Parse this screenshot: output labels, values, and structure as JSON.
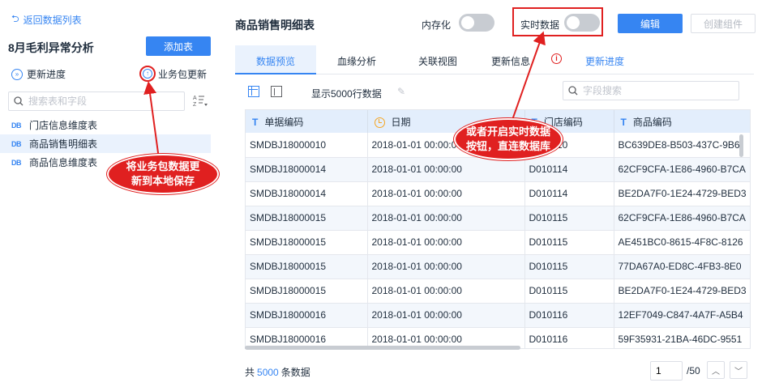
{
  "left": {
    "back_label": "返回数据列表",
    "package_title": "8月毛利异常分析",
    "add_table_label": "添加表",
    "update_progress_label": "更新进度",
    "package_update_label": "业务包更新",
    "search_placeholder": "搜索表和字段",
    "tables": [
      {
        "label": "门店信息维度表",
        "active": false
      },
      {
        "label": "商品销售明细表",
        "active": true
      },
      {
        "label": "商品信息维度表",
        "active": false
      }
    ]
  },
  "main": {
    "title": "商品销售明细表",
    "memory_label": "内存化",
    "realtime_label": "实时数据",
    "edit_label": "编辑",
    "create_component_label": "创建组件",
    "tabs": [
      {
        "label": "数据预览",
        "active": true
      },
      {
        "label": "血缘分析",
        "active": false
      },
      {
        "label": "关联视图",
        "active": false
      },
      {
        "label": "更新信息",
        "active": false
      },
      {
        "label": "更新进度",
        "active": false
      }
    ],
    "row_count_label": "显示5000行数据",
    "field_search_placeholder": "字段搜索"
  },
  "table": {
    "columns": [
      {
        "type": "T",
        "label": "单据编码"
      },
      {
        "type": "clock",
        "label": "日期"
      },
      {
        "type": "T",
        "label": "门店编码"
      },
      {
        "type": "T",
        "label": "商品编码"
      }
    ],
    "rows": [
      [
        "SMDBJ18000010",
        "2018-01-01 00:00:00",
        "D010110",
        "BC639DE8-B503-437C-9B6"
      ],
      [
        "SMDBJ18000014",
        "2018-01-01 00:00:00",
        "D010114",
        "62CF9CFA-1E86-4960-B7CA"
      ],
      [
        "SMDBJ18000014",
        "2018-01-01 00:00:00",
        "D010114",
        "BE2DA7F0-1E24-4729-BED3"
      ],
      [
        "SMDBJ18000015",
        "2018-01-01 00:00:00",
        "D010115",
        "62CF9CFA-1E86-4960-B7CA"
      ],
      [
        "SMDBJ18000015",
        "2018-01-01 00:00:00",
        "D010115",
        "AE451BC0-8615-4F8C-8126"
      ],
      [
        "SMDBJ18000015",
        "2018-01-01 00:00:00",
        "D010115",
        "77DA67A0-ED8C-4FB3-8E0"
      ],
      [
        "SMDBJ18000015",
        "2018-01-01 00:00:00",
        "D010115",
        "BE2DA7F0-1E24-4729-BED3"
      ],
      [
        "SMDBJ18000016",
        "2018-01-01 00:00:00",
        "D010116",
        "12EF7049-C847-4A7F-A5B4"
      ],
      [
        "SMDBJ18000016",
        "2018-01-01 00:00:00",
        "D010116",
        "59F35931-21BA-46DC-9551"
      ]
    ]
  },
  "footer": {
    "total_prefix": "共",
    "total_count": "5000",
    "total_suffix": "条数据",
    "page_value": "1",
    "page_total": "/50"
  },
  "annotations": {
    "left_bubble_line1": "将业务包数据更",
    "left_bubble_line2": "新到本地保存",
    "right_bubble_line1": "或者开启实时数据",
    "right_bubble_line2": "按钮，直连数据库"
  },
  "colors": {
    "accent": "#3685f2",
    "annotation_red": "#e02020"
  }
}
